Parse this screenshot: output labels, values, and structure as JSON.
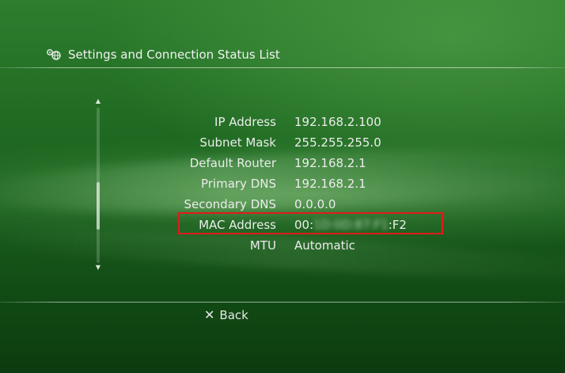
{
  "header": {
    "title": "Settings and Connection Status List",
    "icon": "settings-network-icon"
  },
  "status_rows": [
    {
      "label": "IP Address",
      "value": "192.168.2.100"
    },
    {
      "label": "Subnet Mask",
      "value": "255.255.255.0"
    },
    {
      "label": "Default Router",
      "value": "192.168.2.1"
    },
    {
      "label": "Primary DNS",
      "value": "192.168.2.1"
    },
    {
      "label": "Secondary DNS",
      "value": "0.0.0.0"
    },
    {
      "label": "MAC Address",
      "value_prefix": "00:",
      "value_blurred": "1D:0D:87:F1",
      "value_suffix": ":F2"
    },
    {
      "label": "MTU",
      "value": "Automatic"
    }
  ],
  "highlight_color": "#e01b1b",
  "footer": {
    "back_label": "Back",
    "back_icon": "cross-button-icon"
  }
}
